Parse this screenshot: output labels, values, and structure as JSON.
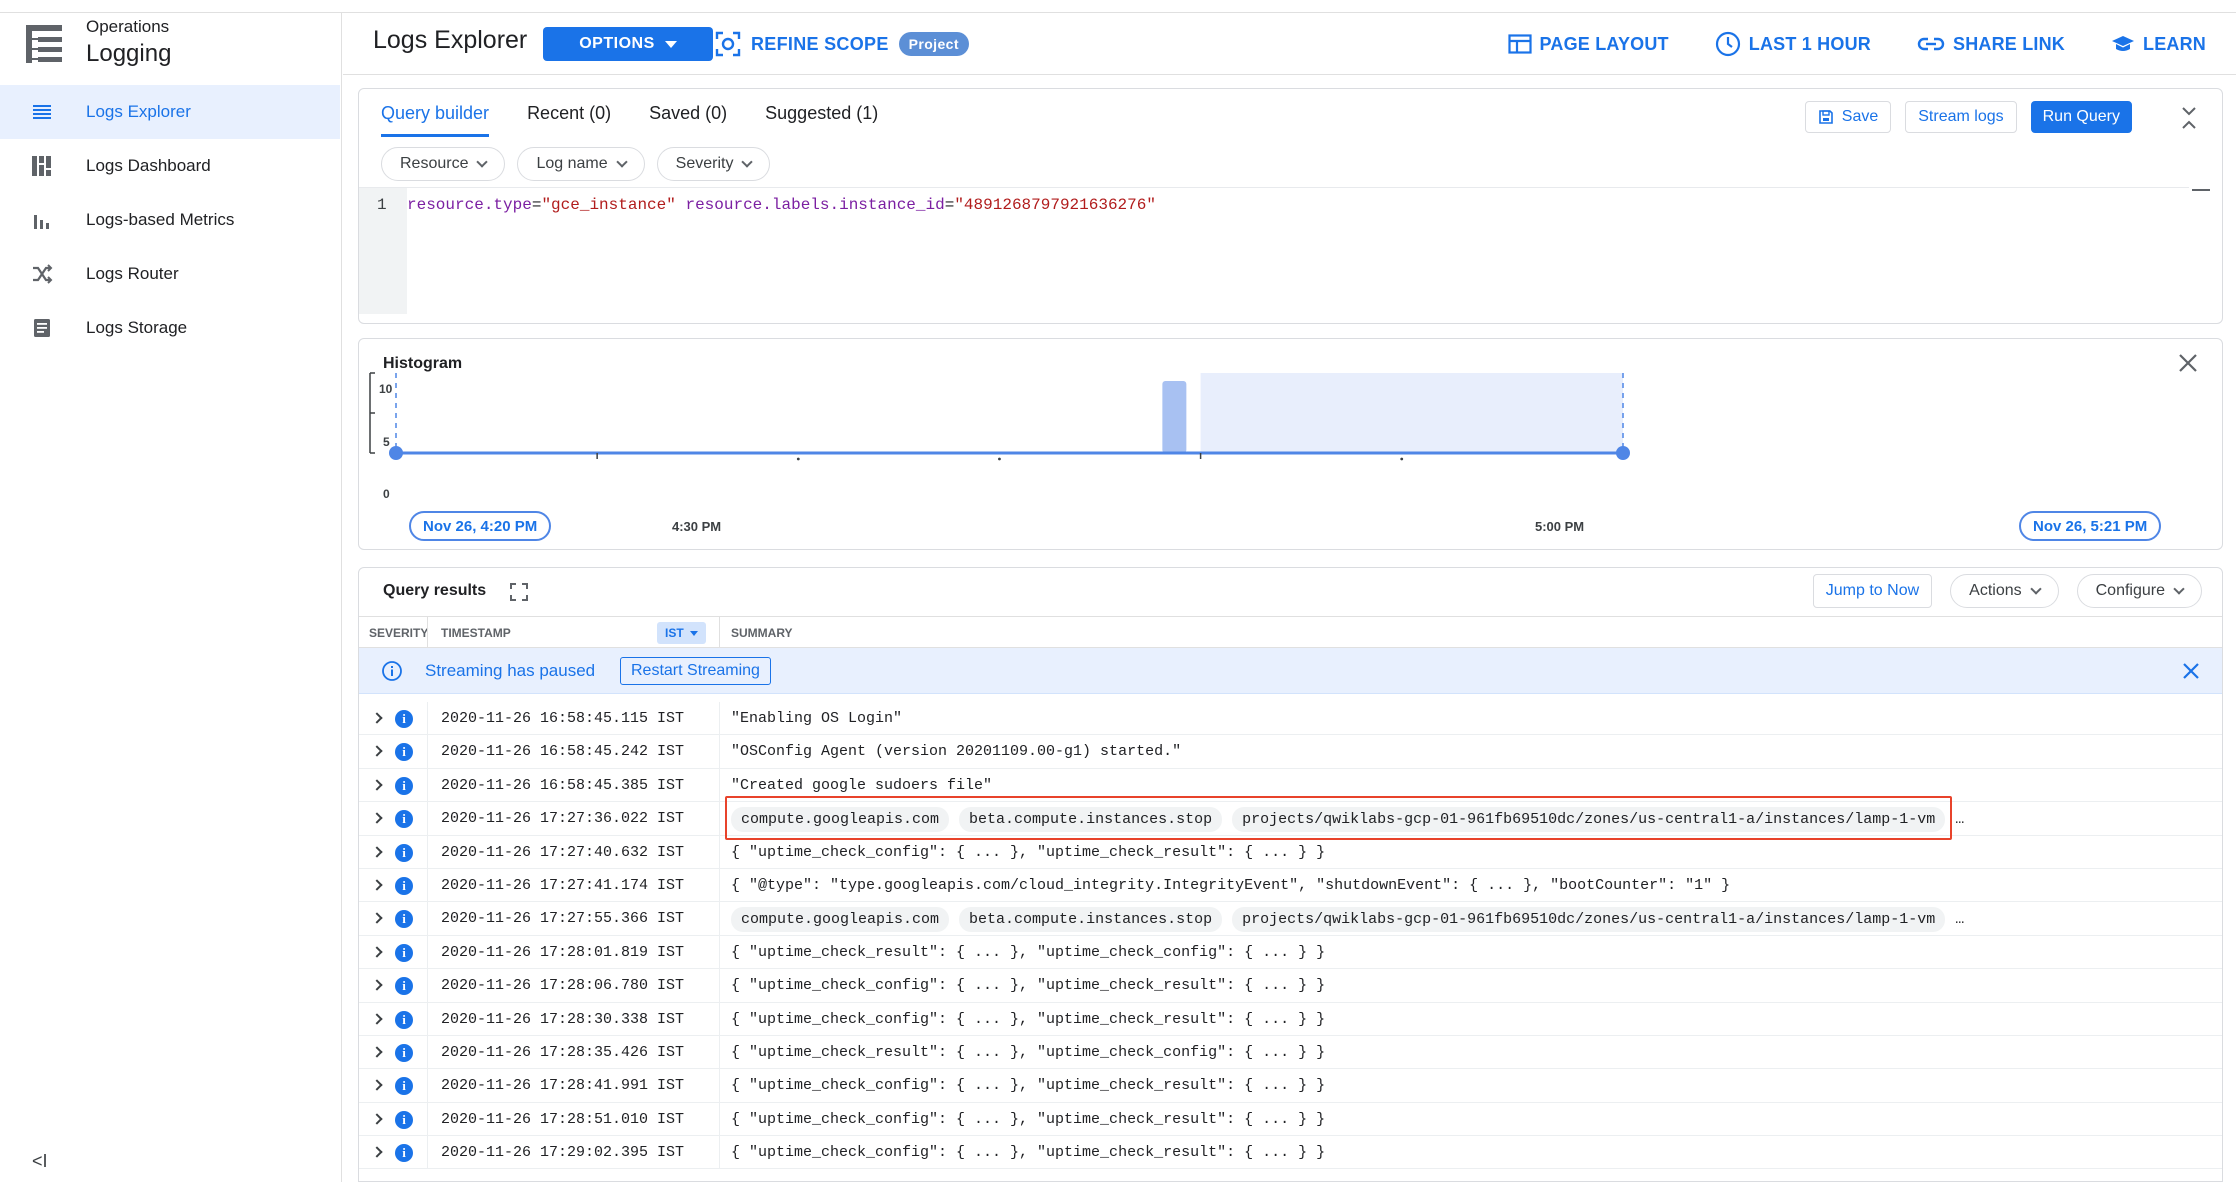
{
  "sidebar": {
    "product_sub": "Operations",
    "product": "Logging",
    "items": [
      {
        "label": "Logs Explorer",
        "icon": "list-icon"
      },
      {
        "label": "Logs Dashboard",
        "icon": "dashboard-icon"
      },
      {
        "label": "Logs-based Metrics",
        "icon": "bar-chart-icon"
      },
      {
        "label": "Logs Router",
        "icon": "shuffle-icon"
      },
      {
        "label": "Logs Storage",
        "icon": "storage-icon"
      }
    ],
    "collapse_glyph": "<I"
  },
  "header": {
    "title": "Logs Explorer",
    "options_label": "OPTIONS",
    "refine_label": "REFINE SCOPE",
    "scope_badge": "Project",
    "actions": {
      "page_layout": "PAGE LAYOUT",
      "time_range": "LAST 1 HOUR",
      "share_link": "SHARE LINK",
      "learn": "LEARN"
    }
  },
  "query": {
    "tabs": [
      "Query builder",
      "Recent (0)",
      "Saved (0)",
      "Suggested (1)"
    ],
    "save_label": "Save",
    "stream_label": "Stream logs",
    "run_label": "Run Query",
    "chips": [
      "Resource",
      "Log name",
      "Severity"
    ],
    "line_number": "1",
    "code": {
      "k1": "resource.type",
      "eq1": "=",
      "v1": "\"gce_instance\"",
      "k2": "resource.labels.instance_id",
      "eq2": "=",
      "v2": "\"4891268797921636276\""
    }
  },
  "histogram": {
    "title": "Histogram",
    "start_label": "Nov 26, 4:20 PM",
    "end_label": "Nov 26, 5:21 PM",
    "tick_labels": [
      "4:30 PM",
      "5:00 PM"
    ],
    "y_ticks": [
      "10",
      "5",
      "0"
    ]
  },
  "chart_data": {
    "type": "bar",
    "title": "Histogram",
    "x_range": [
      "Nov 26, 4:20 PM",
      "Nov 26, 5:21 PM"
    ],
    "x_ticks": [
      "4:30 PM",
      "5:00 PM"
    ],
    "ylim": [
      0,
      10
    ],
    "y_ticks": [
      0,
      5,
      10
    ],
    "bars": [
      {
        "x": "Nov 26, 4:58 PM",
        "value": 9
      }
    ],
    "selected_range": [
      "Nov 26, 5:00 PM",
      "Nov 26, 5:21 PM"
    ]
  },
  "results": {
    "title": "Query results",
    "jump_label": "Jump to Now",
    "actions_label": "Actions",
    "configure_label": "Configure",
    "columns": {
      "severity": "SEVERITY",
      "timestamp": "TIMESTAMP",
      "tz": "IST",
      "summary": "SUMMARY"
    },
    "banner_text": "Streaming has paused",
    "restart_label": "Restart Streaming",
    "rows": [
      {
        "ts": "2020-11-26 16:58:45.115 IST",
        "summary": "\"Enabling OS Login\""
      },
      {
        "ts": "2020-11-26 16:58:45.242 IST",
        "summary": "\"OSConfig Agent (version 20201109.00-g1) started.\""
      },
      {
        "ts": "2020-11-26 16:58:45.385 IST",
        "summary": "\"Created google sudoers file\""
      },
      {
        "ts": "2020-11-26 17:27:36.022 IST",
        "chips": [
          "compute.googleapis.com",
          "beta.compute.instances.stop",
          "projects/qwiklabs-gcp-01-961fb69510dc/zones/us-central1-a/instances/lamp-1-vm"
        ],
        "more": "…"
      },
      {
        "ts": "2020-11-26 17:27:40.632 IST",
        "summary": "{ \"uptime_check_config\": { ... }, \"uptime_check_result\": { ... } }"
      },
      {
        "ts": "2020-11-26 17:27:41.174 IST",
        "summary": "{ \"@type\": \"type.googleapis.com/cloud_integrity.IntegrityEvent\", \"shutdownEvent\": { ... }, \"bootCounter\": \"1\" }"
      },
      {
        "ts": "2020-11-26 17:27:55.366 IST",
        "chips": [
          "compute.googleapis.com",
          "beta.compute.instances.stop",
          "projects/qwiklabs-gcp-01-961fb69510dc/zones/us-central1-a/instances/lamp-1-vm"
        ],
        "more": "…"
      },
      {
        "ts": "2020-11-26 17:28:01.819 IST",
        "summary": "{ \"uptime_check_result\": { ... }, \"uptime_check_config\": { ... } }"
      },
      {
        "ts": "2020-11-26 17:28:06.780 IST",
        "summary": "{ \"uptime_check_config\": { ... }, \"uptime_check_result\": { ... } }"
      },
      {
        "ts": "2020-11-26 17:28:30.338 IST",
        "summary": "{ \"uptime_check_config\": { ... }, \"uptime_check_result\": { ... } }"
      },
      {
        "ts": "2020-11-26 17:28:35.426 IST",
        "summary": "{ \"uptime_check_result\": { ... }, \"uptime_check_config\": { ... } }"
      },
      {
        "ts": "2020-11-26 17:28:41.991 IST",
        "summary": "{ \"uptime_check_config\": { ... }, \"uptime_check_result\": { ... } }"
      },
      {
        "ts": "2020-11-26 17:28:51.010 IST",
        "summary": "{ \"uptime_check_config\": { ... }, \"uptime_check_result\": { ... } }"
      },
      {
        "ts": "2020-11-26 17:29:02.395 IST",
        "summary": "{ \"uptime_check_config\": { ... }, \"uptime_check_result\": { ... } }"
      }
    ]
  },
  "colors": {
    "accent": "#1a73e8",
    "highlight": "#e8432b",
    "bar": "#a8c1f2",
    "selection": "#e8eefc"
  }
}
